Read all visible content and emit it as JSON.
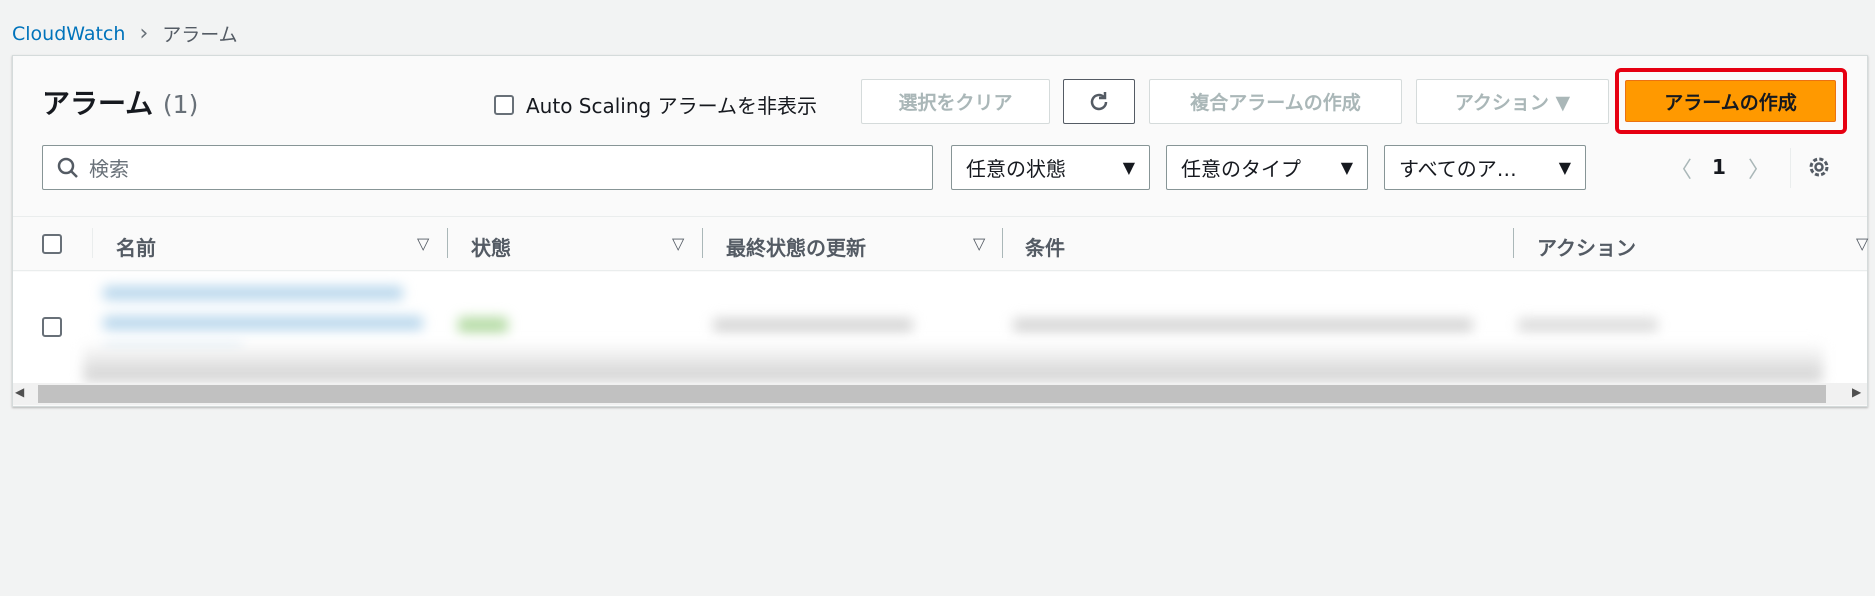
{
  "breadcrumb": {
    "parent": "CloudWatch",
    "current": "アラーム"
  },
  "header": {
    "title": "アラーム",
    "count": "(1)"
  },
  "toolbar": {
    "hide_autoscaling_label": "Auto Scaling アラームを非表示",
    "clear_selection": "選択をクリア",
    "create_composite": "複合アラームの作成",
    "actions": "アクション ▼",
    "create_alarm": "アラームの作成"
  },
  "search": {
    "placeholder": "検索"
  },
  "filters": {
    "state": "任意の状態",
    "type": "任意のタイプ",
    "actions": "すべてのア…"
  },
  "pagination": {
    "page": "1"
  },
  "table": {
    "columns": [
      "名前",
      "状態",
      "最終状態の更新",
      "条件",
      "アクション"
    ]
  },
  "colors": {
    "primary": "#ff9900",
    "highlight": "#e60012",
    "link": "#0073bb"
  }
}
